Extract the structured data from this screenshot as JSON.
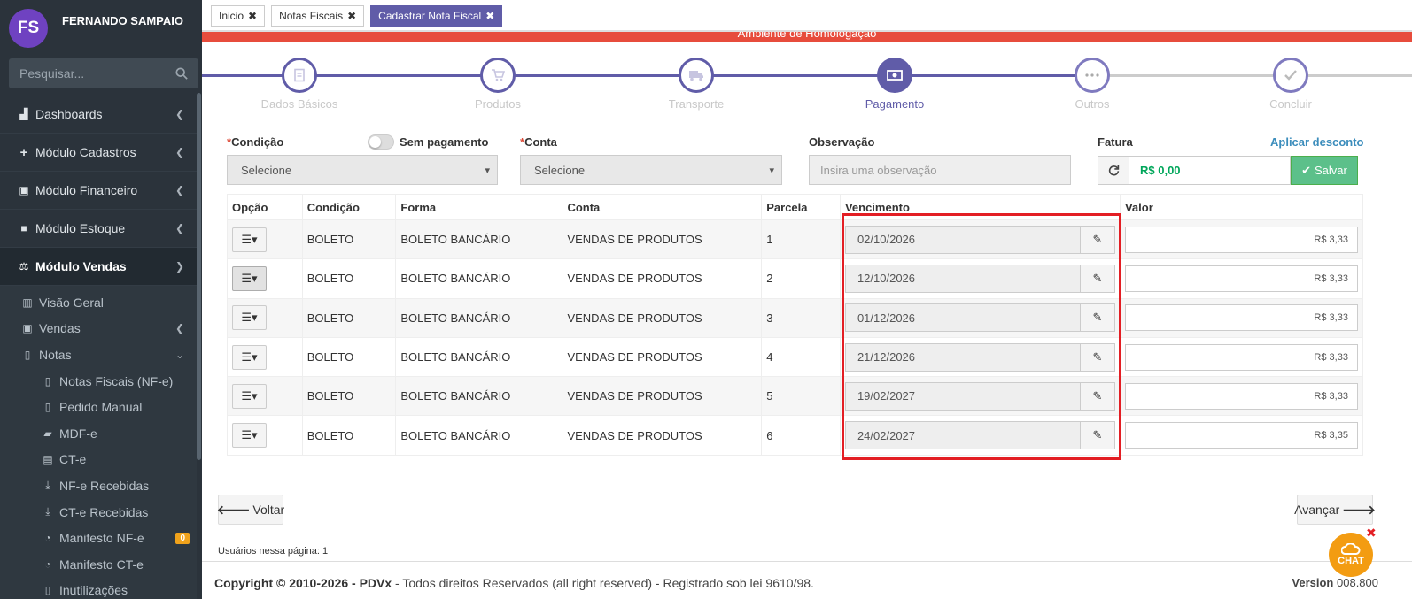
{
  "sidebar": {
    "user_initials": "FS",
    "user_name": "FERNANDO SAMPAIO",
    "search_placeholder": "Pesquisar...",
    "menu": [
      {
        "label": "Dashboards",
        "icon": "area-chart-icon"
      },
      {
        "label": "Módulo Cadastros",
        "icon": "plus-icon"
      },
      {
        "label": "Módulo Financeiro",
        "icon": "money-icon"
      },
      {
        "label": "Módulo Estoque",
        "icon": "box-icon"
      },
      {
        "label": "Módulo Vendas",
        "icon": "balance-scale-icon"
      }
    ],
    "vendas_sub": [
      {
        "label": "Visão Geral",
        "icon": "bar-chart-icon"
      },
      {
        "label": "Vendas",
        "icon": "money-icon"
      },
      {
        "label": "Notas",
        "icon": "file-icon"
      }
    ],
    "notas_sub": [
      {
        "label": "Notas Fiscais (NF-e)",
        "icon": "file-code-icon"
      },
      {
        "label": "Pedido Manual",
        "icon": "file-text-icon"
      },
      {
        "label": "MDF-e",
        "icon": "truck-icon"
      },
      {
        "label": "CT-e",
        "icon": "bus-icon"
      },
      {
        "label": "NF-e Recebidas",
        "icon": "download-icon"
      },
      {
        "label": "CT-e Recebidas",
        "icon": "download-icon"
      },
      {
        "label": "Manifesto NF-e",
        "icon": "rss-icon",
        "badge": "0"
      },
      {
        "label": "Manifesto CT-e",
        "icon": "rss-icon"
      },
      {
        "label": "Inutilizações",
        "icon": "file-excel-icon"
      }
    ]
  },
  "tabs": [
    {
      "label": "Inicio"
    },
    {
      "label": "Notas Fiscais"
    },
    {
      "label": "Cadastrar Nota Fiscal"
    }
  ],
  "env_banner": "Ambiente de Homologação",
  "wizard": {
    "steps": [
      {
        "label": "Dados Básicos",
        "state": "done",
        "icon": "file-icon"
      },
      {
        "label": "Produtos",
        "state": "done",
        "icon": "cart-icon"
      },
      {
        "label": "Transporte",
        "state": "done",
        "icon": "truck-icon"
      },
      {
        "label": "Pagamento",
        "state": "current",
        "icon": "money-icon"
      },
      {
        "label": "Outros",
        "state": "pending",
        "icon": "ellipsis-icon"
      },
      {
        "label": "Concluir",
        "state": "pending",
        "icon": "check-icon"
      }
    ]
  },
  "form": {
    "condicao_label": "Condição",
    "sem_pagamento_label": "Sem pagamento",
    "conta_label": "Conta",
    "observacao_label": "Observação",
    "fatura_label": "Fatura",
    "aplicar_desconto": "Aplicar desconto",
    "condicao_value": "Selecione",
    "conta_value": "Selecione",
    "observacao_placeholder": "Insira uma observação",
    "fatura_value": "R$ 0,00",
    "salvar_label": "Salvar"
  },
  "table": {
    "headers": [
      "Opção",
      "Condição",
      "Forma",
      "Conta",
      "Parcela",
      "Vencimento",
      "Valor"
    ],
    "rows": [
      {
        "condicao": "BOLETO",
        "forma": "BOLETO BANCÁRIO",
        "conta": "VENDAS DE PRODUTOS",
        "parcela": "1",
        "vencimento": "02/10/2026",
        "valor": "R$ 3,33"
      },
      {
        "condicao": "BOLETO",
        "forma": "BOLETO BANCÁRIO",
        "conta": "VENDAS DE PRODUTOS",
        "parcela": "2",
        "vencimento": "12/10/2026",
        "valor": "R$ 3,33"
      },
      {
        "condicao": "BOLETO",
        "forma": "BOLETO BANCÁRIO",
        "conta": "VENDAS DE PRODUTOS",
        "parcela": "3",
        "vencimento": "01/12/2026",
        "valor": "R$ 3,33"
      },
      {
        "condicao": "BOLETO",
        "forma": "BOLETO BANCÁRIO",
        "conta": "VENDAS DE PRODUTOS",
        "parcela": "4",
        "vencimento": "21/12/2026",
        "valor": "R$ 3,33"
      },
      {
        "condicao": "BOLETO",
        "forma": "BOLETO BANCÁRIO",
        "conta": "VENDAS DE PRODUTOS",
        "parcela": "5",
        "vencimento": "19/02/2027",
        "valor": "R$ 3,33"
      },
      {
        "condicao": "BOLETO",
        "forma": "BOLETO BANCÁRIO",
        "conta": "VENDAS DE PRODUTOS",
        "parcela": "6",
        "vencimento": "24/02/2027",
        "valor": "R$ 3,35"
      }
    ]
  },
  "nav": {
    "voltar": "Voltar",
    "avancar": "Avançar"
  },
  "users_on_page": "Usuários nessa página: 1",
  "footer": {
    "copyright_prefix": "Copyright © 2010-2026 - PDVx",
    "copyright_rest": " - Todos direitos Reservados (all right reserved) - Registrado sob lei 9610/98.",
    "version_label": "Version",
    "version_value": "008.800"
  },
  "chat_label": "CHAT",
  "colors": {
    "brand": "#605ca8",
    "sidebar": "#2b333b",
    "banner": "#e74c3c",
    "success": "#00a65a",
    "highlight": "#e31e24"
  }
}
